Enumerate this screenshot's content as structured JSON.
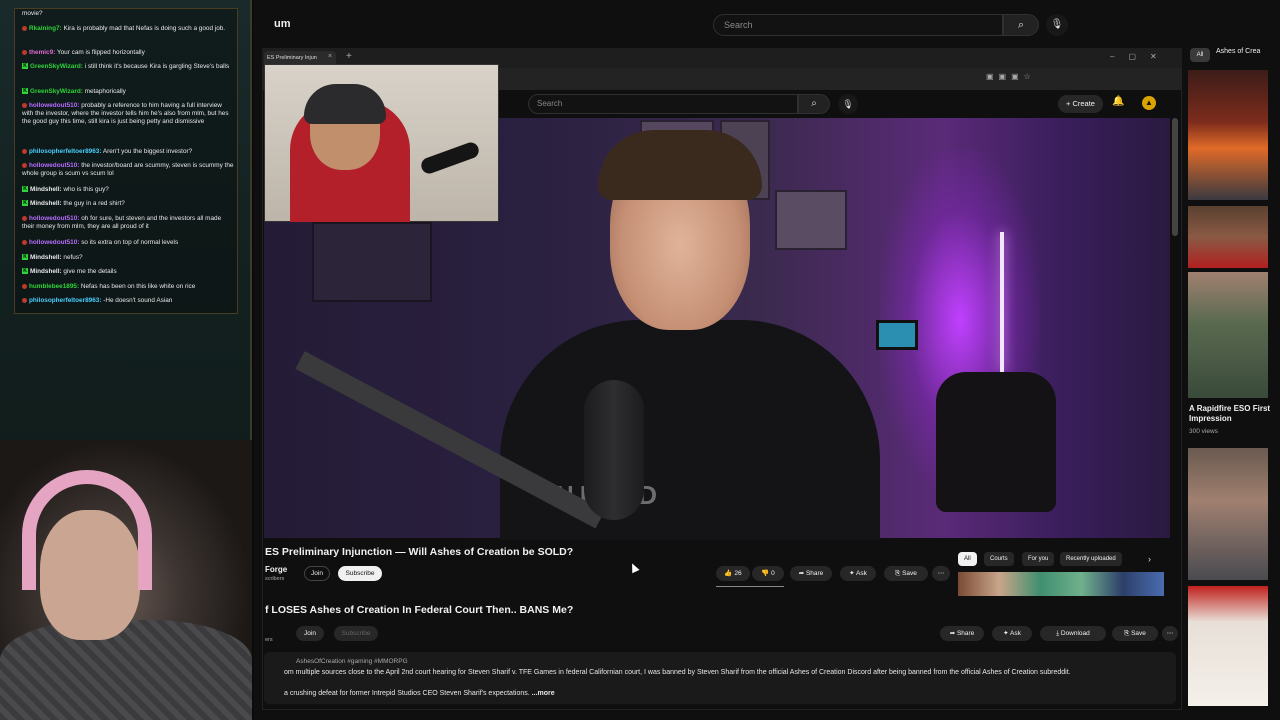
{
  "chat": {
    "lines": [
      {
        "user": "",
        "text": "movie?",
        "color": "#e8e8e8"
      },
      {
        "user": "Rkaining7:",
        "text": " Kira is probably mad that Nefas is doing such a good job.",
        "color": "#2fd43a",
        "badge": "dot"
      },
      {
        "user": "themic9:",
        "text": " Your cam is flipped horizontally",
        "color": "#e06ad0",
        "badge": "dot"
      },
      {
        "user": "GreenSkyWizard:",
        "text": " i still think it's because Kira is gargling Steve's balls",
        "color": "#2fd43a",
        "badge": "k"
      },
      {
        "user": "GreenSkyWizard:",
        "text": " metaphorically",
        "color": "#2fd43a",
        "badge": "k"
      },
      {
        "user": "hollowedout510:",
        "text": " probably a reference to him having a full interview with the investor, where the investor tells him he's also from mlm, but hes the good guy this time, still kira is just being petty and dismissive",
        "color": "#b76cff",
        "badge": "dot"
      },
      {
        "user": "philosopherfeltoer8963:",
        "text": " Aren't you the biggest investor?",
        "color": "#4ad0ff",
        "badge": "dot"
      },
      {
        "user": "hollowedout510:",
        "text": " the investor/board are scummy, steven is scummy the whole group is scum vs scum lol",
        "color": "#b76cff",
        "badge": "dot"
      },
      {
        "user": "Mindshell:",
        "text": " who is this guy?",
        "color": "#e8e8e8",
        "badge": "k"
      },
      {
        "user": "Mindshell:",
        "text": " the guy in a red shirt?",
        "color": "#e8e8e8",
        "badge": "k"
      },
      {
        "user": "hollowedout510:",
        "text": " oh for sure, but steven and the investors all made their money from mlm, they are all proud of it",
        "color": "#b76cff",
        "badge": "dot"
      },
      {
        "user": "hollowedout510:",
        "text": " so its extra on top of normal levels",
        "color": "#b76cff",
        "badge": "dot"
      },
      {
        "user": "Mindshell:",
        "text": " nefus?",
        "color": "#e8e8e8",
        "badge": "k"
      },
      {
        "user": "Mindshell:",
        "text": " give me the details",
        "color": "#e8e8e8",
        "badge": "k"
      },
      {
        "user": "humblebee1895:",
        "text": " Nefas has been on this like white on rice",
        "color": "#2fd43a",
        "badge": "dot"
      },
      {
        "user": "philosopherfeltoer8963:",
        "text": " -He doesn't sound Asian",
        "color": "#4ad0ff",
        "badge": "dot"
      }
    ]
  },
  "outer": {
    "brand": "um",
    "search_placeholder": "Search",
    "search_icon": "search-icon",
    "mic_icon": "mic-icon"
  },
  "inner": {
    "tab_title": "ES Preliminary Injun",
    "search_placeholder": "Search",
    "create_label": "Create"
  },
  "video1": {
    "title": "ES Preliminary Injunction — Will Ashes of Creation be SOLD?",
    "channel": "Forge",
    "subs": "scribers",
    "join": "Join",
    "subscribe": "Subscribe",
    "likes": "26",
    "dislikes": "0",
    "share": "Share",
    "ask": "Ask",
    "save": "Save"
  },
  "chips": [
    "All",
    "Courts",
    "For you",
    "Recently uploaded"
  ],
  "video2": {
    "title": "f LOSES Ashes of Creation In Federal Court Then.. BANS Me?",
    "subs": "ers",
    "join": "Join",
    "subscribe": "Subscribe",
    "share": "Share",
    "ask": "Ask",
    "download": "Download",
    "save": "Save",
    "tags": "AshesOfCreation #gaming #MMORPG",
    "desc1": "om multiple sources close to the April 2nd court hearing for Steven Sharif v. TFE Games in federal Californian court, I was banned by Steven Sharif from the official Ashes of Creation Discord after being banned from the official Ashes of Creation subreddit.",
    "desc2": "a crushing defeat for former Intrepid Studios CEO Steven Sharif's expectations.",
    "more": " ...more"
  },
  "sidebar": {
    "chip_all": "All",
    "chip_2": "Ashes of Crea",
    "video_title": "A Rapidfire ESO First Impression",
    "views": "300 views"
  }
}
